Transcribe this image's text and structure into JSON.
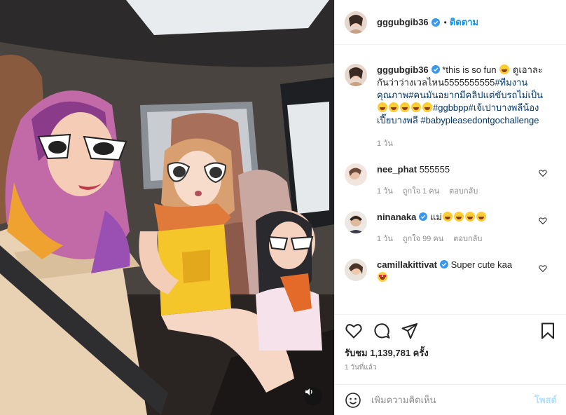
{
  "header": {
    "username": "gggubgib36",
    "dot": "•",
    "follow_label": "ติดตาม"
  },
  "caption": {
    "username": "gggubgib36",
    "text_a": "*this is so fun",
    "text_b": "ดูเอาละกันว่าว่างเวลไหน5555555555",
    "tag1": "#ทีมงานคุณภาพ#คนมันอยากมีคลิปแต่ขับรถไม่เป็น",
    "tag2": "#ggbbpp#เจ้เปาบางพลีน้องเปี๊ยบางพลี",
    "tag3": "#babypleasedontgochallenge",
    "time": "1 วัน"
  },
  "comments": [
    {
      "username": "nee_phat",
      "text": "555555",
      "time": "1 วัน",
      "likes": "ถูกใจ 1 คน",
      "reply": "ตอบกลับ",
      "verified": false
    },
    {
      "username": "ninanaka",
      "text": "แม่",
      "time": "1 วัน",
      "likes": "ถูกใจ 99 คน",
      "reply": "ตอบกลับ",
      "verified": true
    },
    {
      "username": "camillakittivat",
      "text": "Super cute kaa",
      "verified": true
    }
  ],
  "actions": {
    "likes_text": "รับชม 1,139,781 ครั้ง",
    "timestamp": "1 วันที่แล้ว"
  },
  "add_comment": {
    "placeholder": "เพิ่มความคิดเห็น",
    "post_label": "โพสต์"
  },
  "colors": {
    "link": "#0095f6",
    "hashtag": "#00376b",
    "muted": "#8e8e8e",
    "verified": "#3897f0"
  },
  "icons": [
    "heart-icon",
    "comment-icon",
    "share-icon",
    "bookmark-icon",
    "emoji-icon",
    "audio-icon",
    "verified-icon"
  ]
}
